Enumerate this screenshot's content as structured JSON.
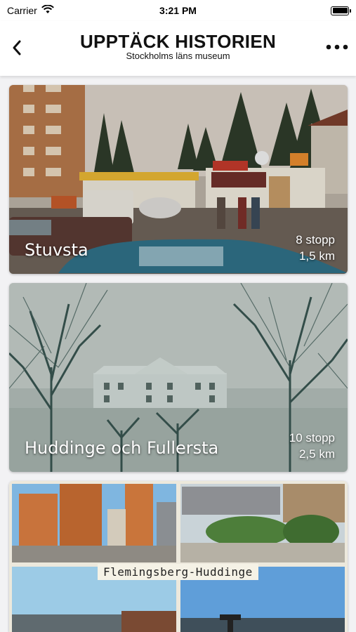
{
  "status_bar": {
    "carrier": "Carrier",
    "time": "3:21 PM",
    "battery_level": 1.0
  },
  "nav": {
    "title": "UPPTÄCK HISTORIEN",
    "subtitle": "Stockholms läns museum",
    "back_icon": "chevron-left-icon",
    "more_icon": "more-dots-icon"
  },
  "tours": [
    {
      "title": "Stuvsta",
      "stops": "8 stopp",
      "distance": "1,5 km"
    },
    {
      "title": "Huddinge och Fullersta",
      "stops": "10 stopp",
      "distance": "2,5 km"
    },
    {
      "caption": "Flemingsberg-Huddinge"
    }
  ]
}
